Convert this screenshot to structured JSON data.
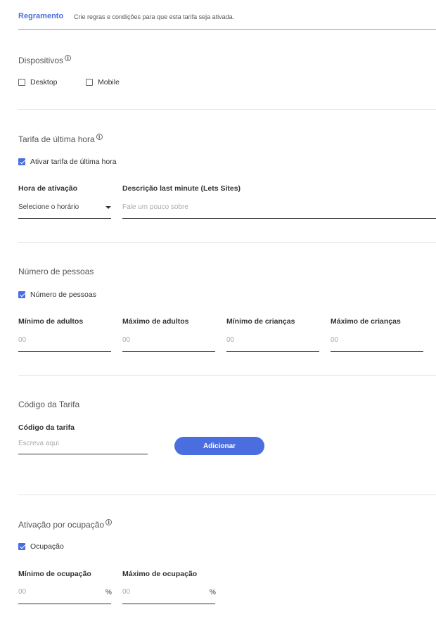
{
  "header": {
    "tab_label": "Regramento",
    "tab_description": "Crie regras e condições para que esta tarifa seja ativada."
  },
  "devices": {
    "title": "Dispositivos",
    "options": [
      {
        "label": "Desktop",
        "checked": false
      },
      {
        "label": "Mobile",
        "checked": false
      }
    ]
  },
  "last_minute": {
    "title": "Tarifa de última hora",
    "checkbox_label": "Ativar tarifa de última hora",
    "checked": true,
    "activation_hour": {
      "label": "Hora de ativação",
      "value": "Selecione o horário"
    },
    "description": {
      "label": "Descrição last minute (Lets Sites)",
      "placeholder": "Fale um pouco sobre"
    }
  },
  "people": {
    "title": "Número de pessoas",
    "checkbox_label": "Número de pessoas",
    "checked": true,
    "fields": [
      {
        "label": "Mínimo de adultos",
        "placeholder": "00"
      },
      {
        "label": "Máximo de adultos",
        "placeholder": "00"
      },
      {
        "label": "Mínimo de crianças",
        "placeholder": "00"
      },
      {
        "label": "Máximo de crianças",
        "placeholder": "00"
      }
    ]
  },
  "rate_code": {
    "title": "Código da Tarifa",
    "field_label": "Código da tarifa",
    "placeholder": "Escreva aqui",
    "button_label": "Adicionar"
  },
  "occupancy": {
    "title": "Ativação por ocupação",
    "checkbox_label": "Ocupação",
    "checked": true,
    "fields": [
      {
        "label": "Mínimo de ocupação",
        "placeholder": "00",
        "unit": "%"
      },
      {
        "label": "Máximo de ocupação",
        "placeholder": "00",
        "unit": "%"
      }
    ]
  },
  "colors": {
    "accent": "#4a6ee0",
    "divider": "#e6e6e6"
  },
  "icons": [
    "info-icon",
    "checkbox-icon",
    "chevron-down-icon"
  ]
}
